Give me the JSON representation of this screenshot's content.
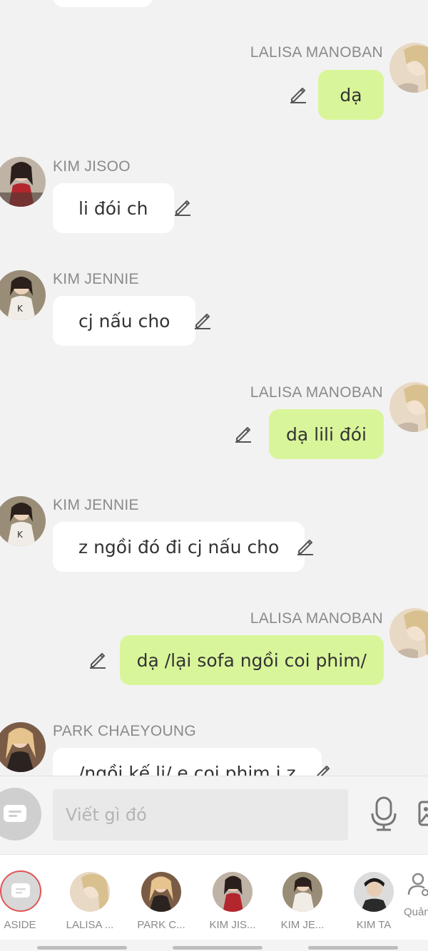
{
  "messages": [
    {
      "sender": "LALISA MANOBAN",
      "text": "dạ",
      "side": "out",
      "avatar": "lalisa"
    },
    {
      "sender": "KIM JISOO",
      "text": "li đói ch",
      "side": "in",
      "avatar": "jisoo"
    },
    {
      "sender": "KIM JENNIE",
      "text": "cj nấu cho",
      "side": "in",
      "avatar": "jennie"
    },
    {
      "sender": "LALISA MANOBAN",
      "text": "dạ lili đói",
      "side": "out",
      "avatar": "lalisa"
    },
    {
      "sender": "KIM JENNIE",
      "text": "z ngồi đó đi cj nấu cho",
      "side": "in",
      "avatar": "jennie"
    },
    {
      "sender": "LALISA MANOBAN",
      "text": "dạ /lại sofa ngồi coi phim/",
      "side": "out",
      "avatar": "lalisa"
    },
    {
      "sender": "PARK CHAEYOUNG",
      "text": "/ngồi kế li/ e coi phim j z",
      "side": "in",
      "avatar": "chaeyoung"
    }
  ],
  "composer": {
    "placeholder": "Viết gì đó",
    "icons": {
      "menu": "chat-menu-icon",
      "mic": "microphone-icon",
      "gallery": "image-icon"
    }
  },
  "tabs": [
    {
      "label": "ASIDE",
      "icon": "chat-menu-icon",
      "selected": true
    },
    {
      "label": "LALISA ...",
      "avatar": "lalisa"
    },
    {
      "label": "PARK C...",
      "avatar": "chaeyoung"
    },
    {
      "label": "KIM JIS...",
      "avatar": "jisoo"
    },
    {
      "label": "KIM JE...",
      "avatar": "jennie"
    },
    {
      "label": "KIM TA",
      "avatar": "taehyung"
    },
    {
      "label": "Quản",
      "icon": "user-settings-icon"
    }
  ],
  "colors": {
    "outgoing_bubble": "#d9f59a",
    "incoming_bubble": "#ffffff",
    "background": "#f2f2f2",
    "sender_name": "#8a8a8a",
    "selected_tab_ring": "#e05555"
  }
}
